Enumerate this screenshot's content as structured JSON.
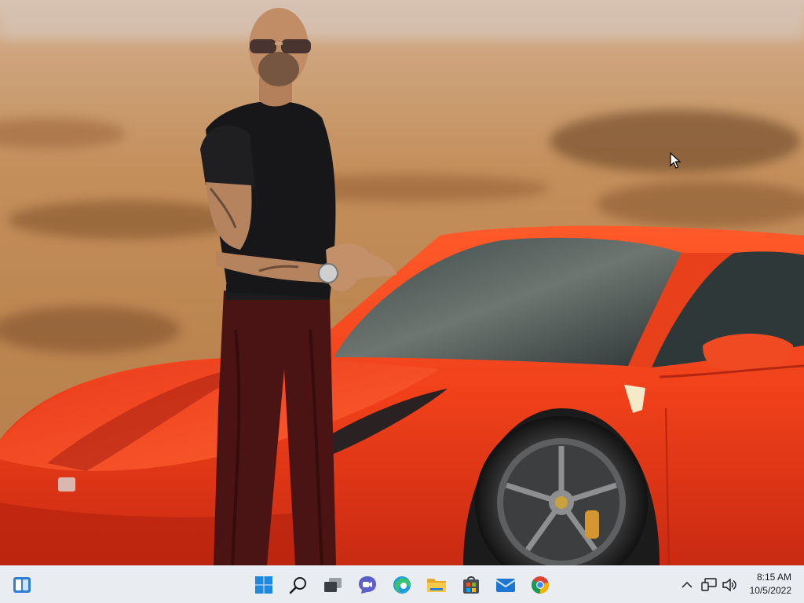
{
  "desktop": {
    "wallpaper": "photo-wallpaper-man-with-red-sports-car",
    "colors": {
      "car_red": "#f2401c",
      "shirt": "#17171a",
      "trousers": "#4a1414",
      "sand": "#c38e5c"
    }
  },
  "taskbar": {
    "left_widget_icon": "widgets-icon",
    "pinned": [
      {
        "name": "start-button",
        "icon": "windows-logo-icon"
      },
      {
        "name": "search-button",
        "icon": "search-icon"
      },
      {
        "name": "task-view-button",
        "icon": "task-view-icon"
      },
      {
        "name": "chat-button",
        "icon": "teams-chat-icon"
      },
      {
        "name": "edge-button",
        "icon": "edge-icon"
      },
      {
        "name": "file-explorer-button",
        "icon": "folder-icon"
      },
      {
        "name": "store-button",
        "icon": "store-icon"
      },
      {
        "name": "mail-button",
        "icon": "mail-icon"
      },
      {
        "name": "chrome-button",
        "icon": "chrome-icon"
      }
    ],
    "tray": {
      "icons": [
        "chevron-up-icon",
        "network-icon",
        "volume-icon"
      ]
    },
    "clock": {
      "time": "8:15 AM",
      "date": "10/5/2022"
    }
  }
}
